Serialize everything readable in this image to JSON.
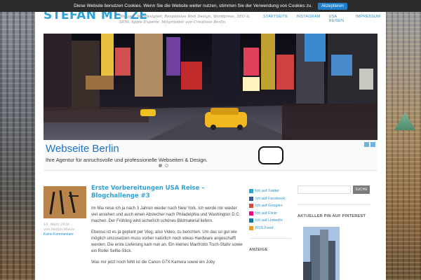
{
  "cookie_bar": {
    "message": "Diese Website benutzen Cookies. Wenn Sie die Website weiter nutzen, stimmen Sie der Verwendung von Cookies zu.",
    "accept_label": "Akzeptieren"
  },
  "header": {
    "site_title": "STEFAN METZE",
    "tagline": "Blogger, Webdesigner, Responsive Web Design, Wordpress, SEO & SEM, Apple Experte, Mitgründer von Creatives Berlin",
    "nav": [
      "STARTSEITE",
      "INSTAGRAM",
      "USA REISEN",
      "IMPRESSUM"
    ]
  },
  "ad": {
    "title": "Webseite Berlin",
    "description": "Ihre Agentur für anruchsvolle und professionelle Webseiten & Design."
  },
  "post": {
    "title": "Erste Vorbereitungen USA Reise – Blogchallenge #3",
    "date": "10. März 2016",
    "author_line": "von Stefan Metze",
    "comments_label": "Keine Kommentare",
    "paragraphs": [
      "Im Mai reise ich ja nach 3 Jahren wieder nach New York. Ich werde mir wieder viel ansehen und auch einen Abstecher nach Philadelphia und Washington D.C. machen. Der Frühling wird sicherlich schönes Bildmaterial liefern.",
      "Ebenso ist es ja geplant per Vlog, also Video, zu berichten. Um das so gut wie möglich umzusetzen muss vorher natürlich noch etwas Hardware angeschafft werden. Die erste Lieferung kam nun an. Ein kleines Manfrotto Tisch-Stativ sowie ein Rollei Selfie-Stick.",
      "Was mir jetzt noch fehlt ist die Canon G7X Kamera sowie ein Joby"
    ]
  },
  "social": {
    "items": [
      {
        "label": "Ich auf Twitter",
        "color": "#2da1d9"
      },
      {
        "label": "Ich auf Facebook",
        "color": "#3b5998"
      },
      {
        "label": "Ich auf Google+",
        "color": "#d64937"
      },
      {
        "label": "Ich auf Flickr",
        "color": "#ff0084"
      },
      {
        "label": "Ich auf LinkedIn",
        "color": "#0e76a8"
      },
      {
        "label": "RSS Feed",
        "color": "#f39a1d"
      }
    ],
    "anzeige_heading": "ANZEIGE"
  },
  "sidebar": {
    "search_button": "SUCHE",
    "pinterest_heading": "AKTUELLER PIN AUF PINTEREST"
  }
}
